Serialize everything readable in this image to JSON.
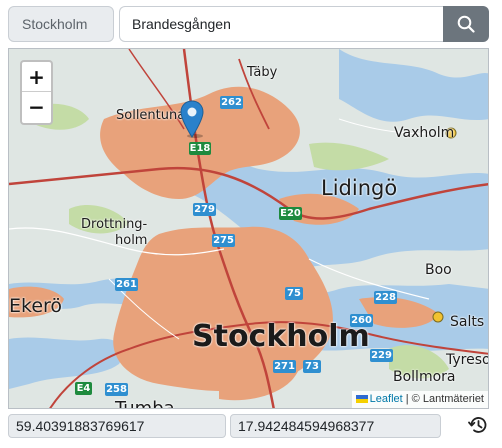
{
  "search": {
    "city": "Stockholm",
    "street": "Brandesgången"
  },
  "map": {
    "zoom_in": "+",
    "zoom_out": "−",
    "places": {
      "taby": "Täby",
      "sollentuna": "Sollentuna",
      "vaxholm": "Vaxholm",
      "lidingo": "Lidingö",
      "drottningholm_1": "Drottning-",
      "drottningholm_2": "holm",
      "ekero": "Ekerö",
      "boo": "Boo",
      "saltsjobaden": "Salts",
      "stockholm": "Stockholm",
      "tyreso": "Tyreso",
      "bollmora": "Bollmora",
      "tumba": "Tumba"
    },
    "road_signs": {
      "r262": "262",
      "e18": "E18",
      "r279": "279",
      "e20": "E20",
      "r275": "275",
      "r261": "261",
      "r75": "75",
      "r228": "228",
      "r260": "260",
      "r229": "229",
      "r271": "271",
      "r73": "73",
      "e4": "E4",
      "r258": "258"
    },
    "attribution": {
      "leaflet": "Leaflet",
      "separator": " | © ",
      "provider": "Lantmäteriet"
    }
  },
  "coordinates": {
    "latitude": "59.40391883769617",
    "longitude": "17.942484594968377"
  },
  "icons": {
    "search": "search-icon",
    "marker": "map-marker-icon",
    "history": "history-icon",
    "flag": "ukraine-flag-icon"
  },
  "colors": {
    "land": "#dfe6e3",
    "urban": "#e8a27b",
    "forest": "#c4dca6",
    "water": "#a9cbe8",
    "road_major": "#c0443b",
    "marker": "#2a81cb",
    "button": "#6c757d"
  }
}
